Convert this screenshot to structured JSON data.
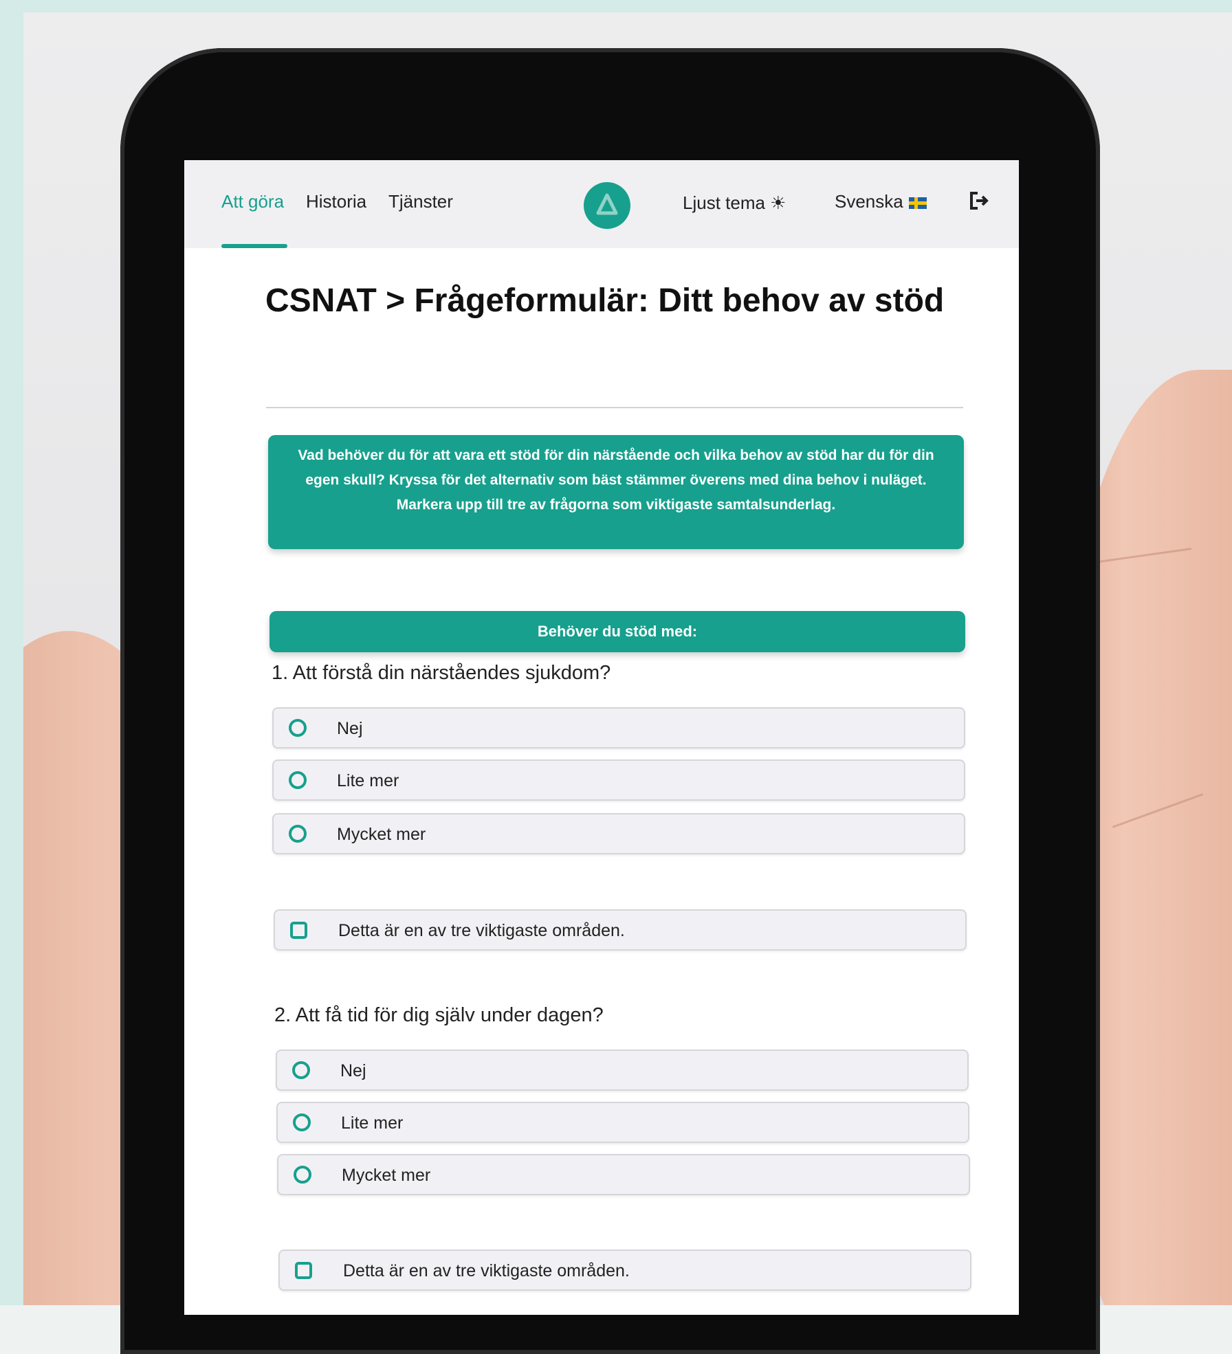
{
  "nav": {
    "links": [
      {
        "label": "Att göra",
        "active": true
      },
      {
        "label": "Historia",
        "active": false
      },
      {
        "label": "Tjänster",
        "active": false
      }
    ],
    "logo_icon": "app-logo-icon",
    "theme_toggle": "Ljust tema ☀",
    "language": "Svenska",
    "language_icon": "swedish-flag-icon",
    "logout_icon": "logout-icon"
  },
  "page": {
    "title": "CSNAT > Frågeformulär: Ditt behov av stöd",
    "intro": "Vad behöver du för att vara ett stöd för din närstående och vilka behov av stöd har du för din egen skull? Kryssa för det alternativ som bäst stämmer överens med dina behov i nuläget. Markera upp till tre av frågorna som viktigaste samtalsunderlag.",
    "section_heading": "Behöver du stöd med:"
  },
  "questions": [
    {
      "text": "1. Att förstå din närståendes sjukdom?",
      "options": [
        "Nej",
        "Lite mer",
        "Mycket mer"
      ],
      "priority_label": "Detta är en av tre viktigaste områden."
    },
    {
      "text": "2. Att få tid för dig själv under dagen?",
      "options": [
        "Nej",
        "Lite mer",
        "Mycket mer"
      ],
      "priority_label": "Detta är en av tre viktigaste områden."
    }
  ],
  "colors": {
    "accent": "#17a08d",
    "option_bg": "#f1f1f5",
    "nav_bg": "#f0f0f3"
  }
}
